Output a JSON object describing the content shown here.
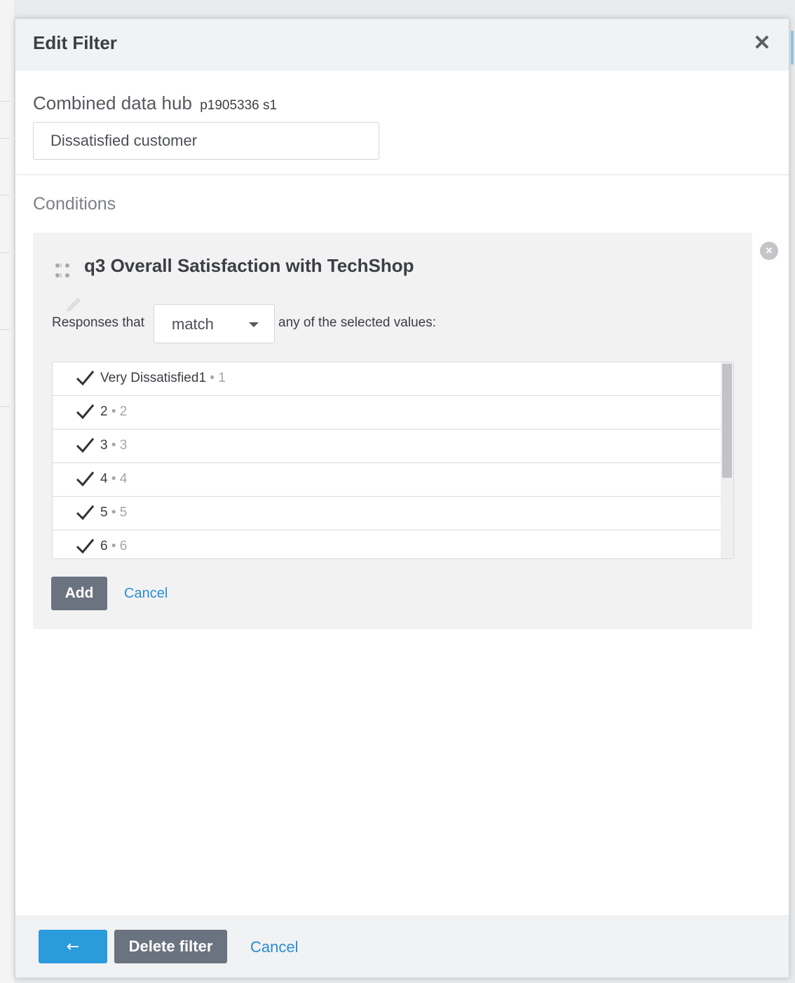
{
  "dialog": {
    "title": "Edit Filter",
    "close_icon": "close-icon"
  },
  "hub": {
    "label": "Combined data hub",
    "id": "p1905336 s1"
  },
  "filter_name": {
    "value": "Dissatisfied customer"
  },
  "conditions": {
    "label": "Conditions",
    "condition": {
      "title": "q3 Overall Satisfaction with TechShop",
      "responses_prefix": "Responses that",
      "operator": "match",
      "responses_suffix": "any of the selected values:",
      "values": [
        {
          "label": "Very Dissatisfied1",
          "count": "• 1",
          "checked": true
        },
        {
          "label": "2",
          "count": "• 2",
          "checked": true
        },
        {
          "label": "3",
          "count": "• 3",
          "checked": true
        },
        {
          "label": "4",
          "count": "• 4",
          "checked": true
        },
        {
          "label": "5",
          "count": "• 5",
          "checked": true
        },
        {
          "label": "6",
          "count": "• 6",
          "checked": true
        }
      ],
      "add_label": "Add",
      "cancel_label": "Cancel"
    }
  },
  "footer": {
    "back_label": "←",
    "delete_label": "Delete filter",
    "cancel_label": "Cancel"
  },
  "colors": {
    "accent": "#2a9bdb",
    "button_gray": "#6b7280",
    "link": "#2b8dd0"
  }
}
